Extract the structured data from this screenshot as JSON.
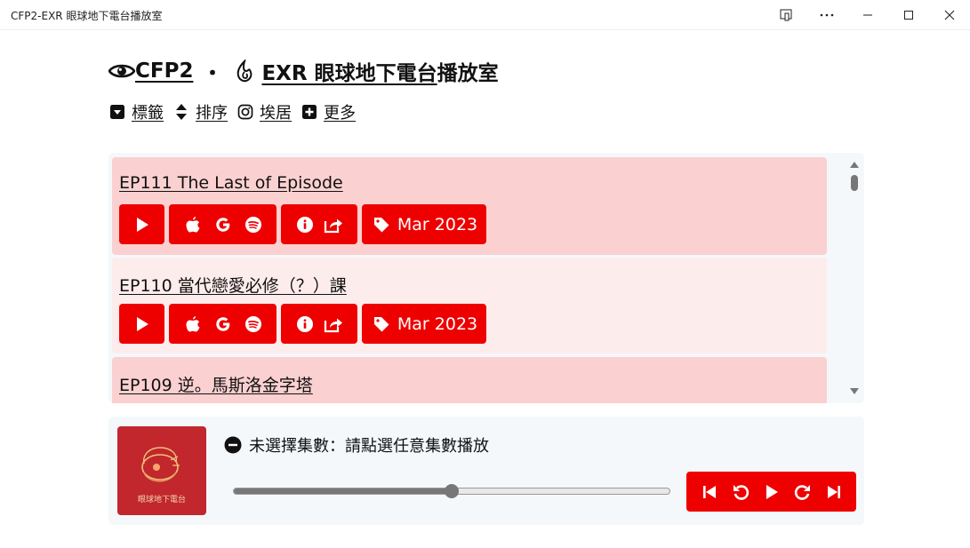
{
  "window": {
    "title": "CFP2-EXR 眼球地下電台播放室"
  },
  "header": {
    "brand": "CFP2",
    "separator": "・",
    "show_name": "EXR 眼球地下電台",
    "page_name": "播放室"
  },
  "subnav": [
    {
      "icon": "caret-square-down-icon",
      "label": "標籤"
    },
    {
      "icon": "sort-icon",
      "label": "排序"
    },
    {
      "icon": "instagram-icon",
      "label": "埃居"
    },
    {
      "icon": "plus-square-icon",
      "label": "更多"
    }
  ],
  "episodes": [
    {
      "title": "EP111 The Last of Episode",
      "date": "Mar 2023"
    },
    {
      "title": "EP110 當代戀愛必修（？）課",
      "date": "Mar 2023"
    },
    {
      "title": "EP109 逆。馬斯洛金字塔",
      "date": ""
    }
  ],
  "episode_buttons": {
    "play": "play-icon",
    "platforms": [
      "apple-icon",
      "google-icon",
      "spotify-icon"
    ],
    "info": [
      "info-icon",
      "share-icon"
    ],
    "tag": "tag-icon"
  },
  "player": {
    "cover_text": "眼球地下電台",
    "status_text": "未選擇集數：請點選任意集數播放",
    "progress": 0.5,
    "controls": [
      "skip-back-icon",
      "rewind-icon",
      "play-icon",
      "forward-icon",
      "skip-forward-icon"
    ]
  },
  "colors": {
    "accent": "#ee0000",
    "row_odd": "#fbd0d0",
    "row_even": "#fdecec",
    "panel": "#f4f8fb",
    "cover": "#c1272d"
  }
}
